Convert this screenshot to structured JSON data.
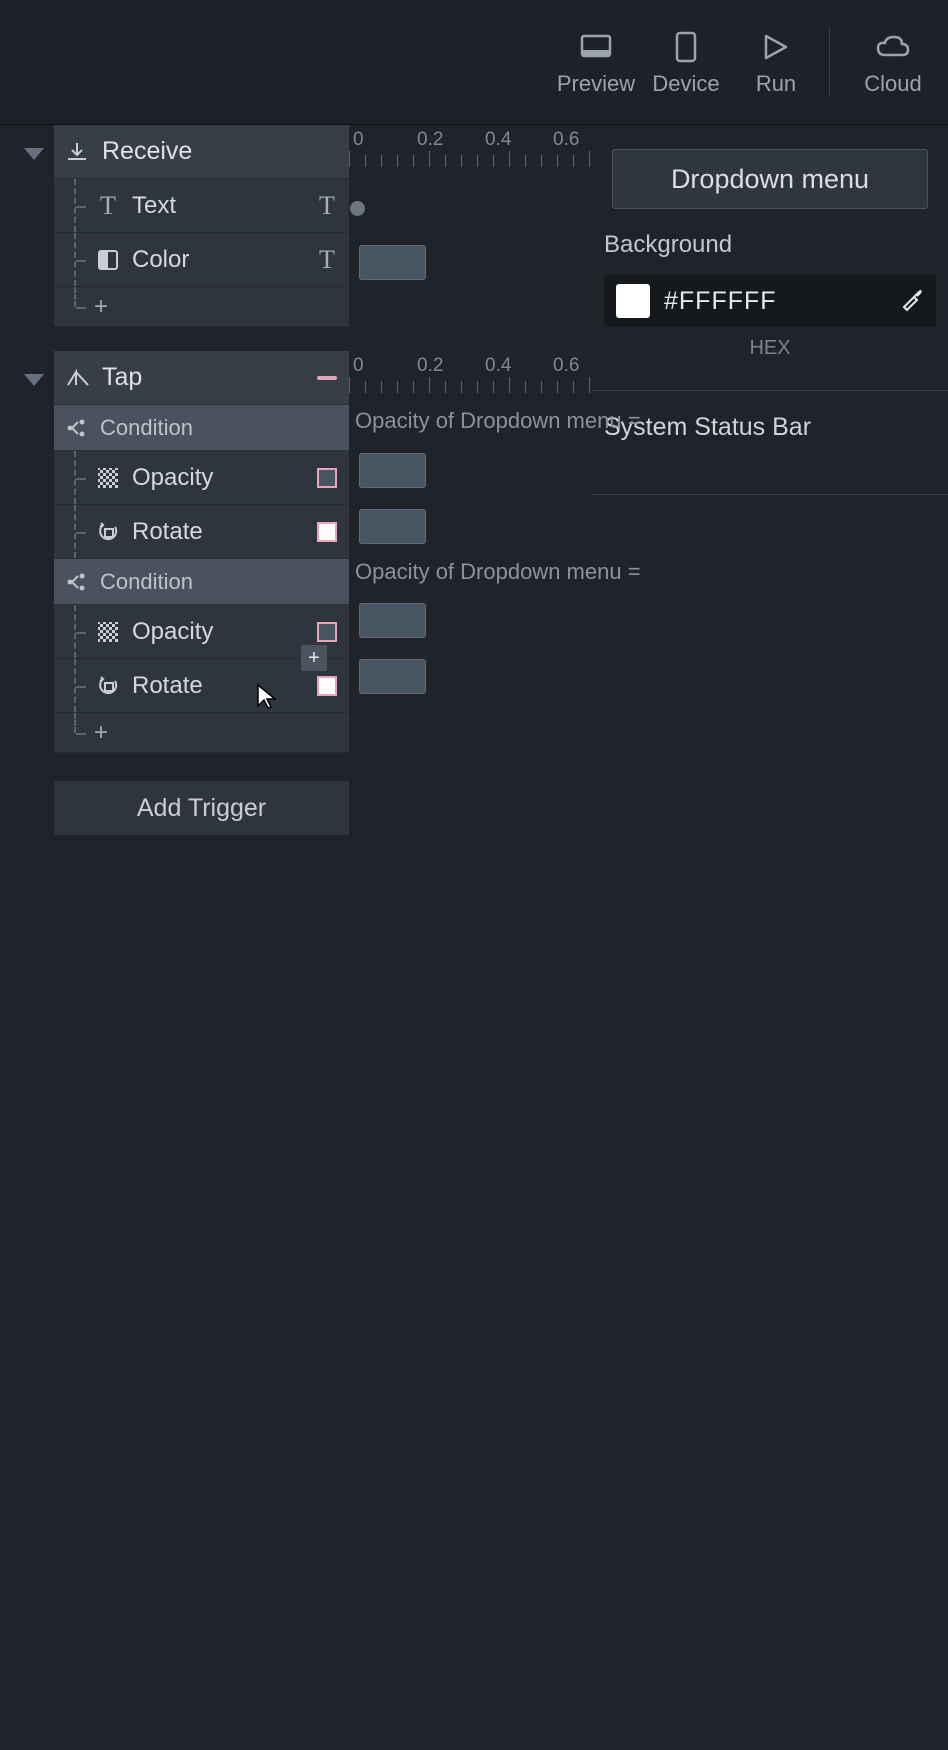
{
  "toolbar": {
    "preview": "Preview",
    "device": "Device",
    "run": "Run",
    "cloud": "Cloud"
  },
  "sections": {
    "receive": {
      "title": "Receive",
      "rows": {
        "text": "Text",
        "color": "Color",
        "add": "+"
      }
    },
    "tap": {
      "title": "Tap",
      "condition_label": "Condition",
      "opacity": "Opacity",
      "rotate": "Rotate",
      "add": "+"
    }
  },
  "add_trigger": "Add Trigger",
  "timeline": {
    "ticks": [
      "0",
      "0.2",
      "0.4",
      "0.6"
    ],
    "condition_text": "Opacity of Dropdown menu ="
  },
  "inspector": {
    "title": "Dropdown menu",
    "background_label": "Background",
    "color_hex": "#FFFFFF",
    "hex_caption": "HEX",
    "system_status": "System Status Bar"
  },
  "colors": {
    "swatch": "#FFFFFF"
  },
  "float_plus": "+"
}
